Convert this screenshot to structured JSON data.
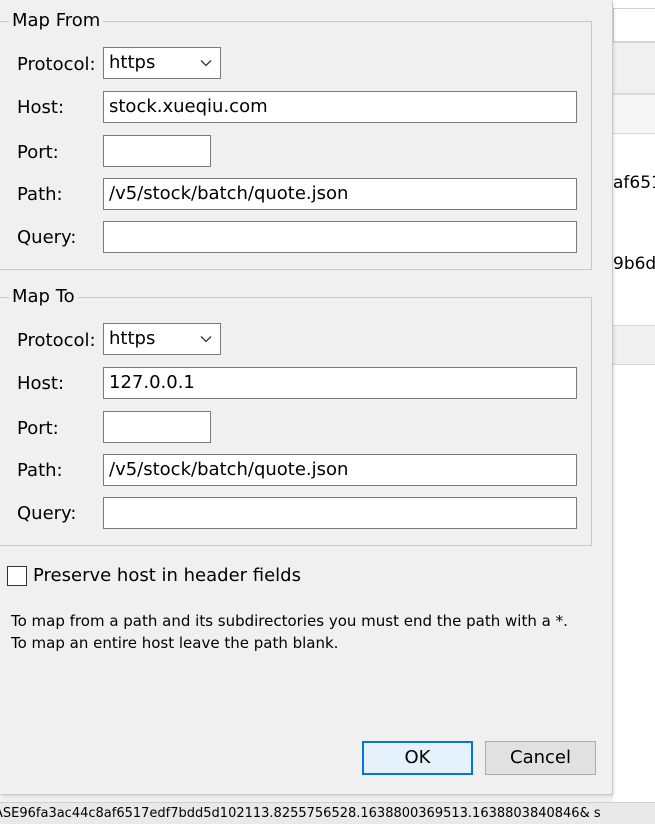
{
  "map_from": {
    "title": "Map From",
    "protocol_label": "Protocol:",
    "protocol_value": "https",
    "host_label": "Host:",
    "host_value": "stock.xueqiu.com",
    "port_label": "Port:",
    "port_value": "",
    "path_label": "Path:",
    "path_value": "/v5/stock/batch/quote.json",
    "query_label": "Query:",
    "query_value": ""
  },
  "map_to": {
    "title": "Map To",
    "protocol_label": "Protocol:",
    "protocol_value": "https",
    "host_label": "Host:",
    "host_value": "127.0.0.1",
    "port_label": "Port:",
    "port_value": "",
    "path_label": "Path:",
    "path_value": "/v5/stock/batch/quote.json",
    "query_label": "Query:",
    "query_value": ""
  },
  "preserve_host": {
    "label": "Preserve host in header fields",
    "checked": false
  },
  "help_text": "To map from a path and its subdirectories you must end the path with a *. To map an entire host leave the path blank.",
  "buttons": {
    "ok": "OK",
    "cancel": "Cancel"
  },
  "background_window": {
    "fragment_1": "af651",
    "fragment_2": "9b6d",
    "status_text": "ASE96fa3ac44c8af6517edf7bdd5d102113.8255756528.1638800369513.1638803840846&  s"
  },
  "icons": {
    "dropdown": "chevron-down-icon"
  }
}
